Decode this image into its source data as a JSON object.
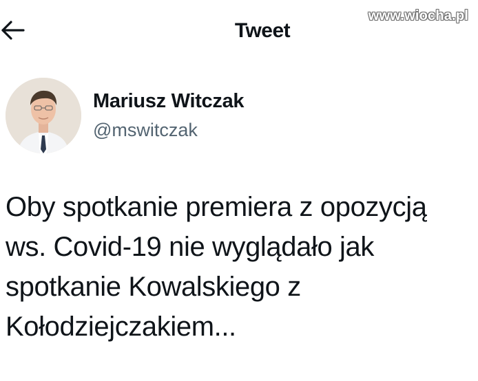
{
  "header": {
    "title": "Tweet",
    "back_icon": "arrow-left-icon"
  },
  "watermark": {
    "text": "www.wiocha.pl"
  },
  "author": {
    "name": "Mariusz Witczak",
    "handle": "@mswitczak"
  },
  "tweet": {
    "text": "Oby spotkanie premiera z opozycją\nws. Covid-19 nie wyglądało jak\nspotkanie Kowalskiego z\nKołodziejczakiem..."
  },
  "colors": {
    "text_primary": "#0f1419",
    "text_secondary": "#536471",
    "background": "#ffffff"
  }
}
